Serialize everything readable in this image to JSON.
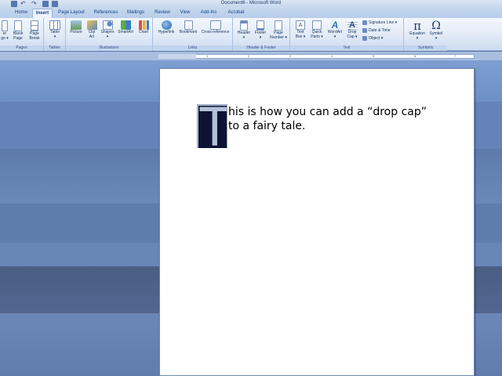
{
  "window": {
    "title": "Document6 - Microsoft Word"
  },
  "tabs": [
    {
      "label": "Home",
      "active": false
    },
    {
      "label": "Insert",
      "active": true
    },
    {
      "label": "Page Layout",
      "active": false
    },
    {
      "label": "References",
      "active": false
    },
    {
      "label": "Mailings",
      "active": false
    },
    {
      "label": "Review",
      "active": false
    },
    {
      "label": "View",
      "active": false
    },
    {
      "label": "Add-Ins",
      "active": false
    },
    {
      "label": "Acrobat",
      "active": false
    }
  ],
  "ribbon": {
    "groups": {
      "pages": "Pages",
      "tables": "Tables",
      "illustrations": "Illustrations",
      "links": "Links",
      "header_footer": "Header & Footer",
      "text": "Text",
      "symbols": "Symbols"
    },
    "buttons": {
      "cover_page": "er\nge ▾",
      "blank_page": "Blank\nPage",
      "page_break": "Page\nBreak",
      "table": "Table\n▾",
      "picture": "Picture",
      "clip_art": "Clip\nArt",
      "shapes": "Shapes\n▾",
      "smartart": "SmartArt",
      "chart": "Chart",
      "hyperlink": "Hyperlink",
      "bookmark": "Bookmark",
      "cross_reference": "Cross-reference",
      "header": "Header\n▾",
      "footer": "Footer\n▾",
      "page_number": "Page\nNumber ▾",
      "text_box": "Text\nBox ▾",
      "quick_parts": "Quick\nParts ▾",
      "wordart": "WordArt\n▾",
      "drop_cap": "Drop\nCap ▾",
      "signature_line": "Signature Line ▾",
      "date_time": "Date & Time",
      "object": "Object ▾",
      "equation": "Equation\n▾",
      "symbol": "Symbol\n▾"
    }
  },
  "ruler": {
    "marks": [
      "1",
      "2",
      "3",
      "4",
      "5",
      "6",
      "7"
    ]
  },
  "document": {
    "drop_cap_letter": "T",
    "line1": "his is how you can add a “drop cap”",
    "line2": "to a fairy tale."
  },
  "colors": {
    "dropcap_bg": "#0d1330",
    "dropcap_fg": "#b3c1d8",
    "ribbon_accent": "#15428b"
  }
}
